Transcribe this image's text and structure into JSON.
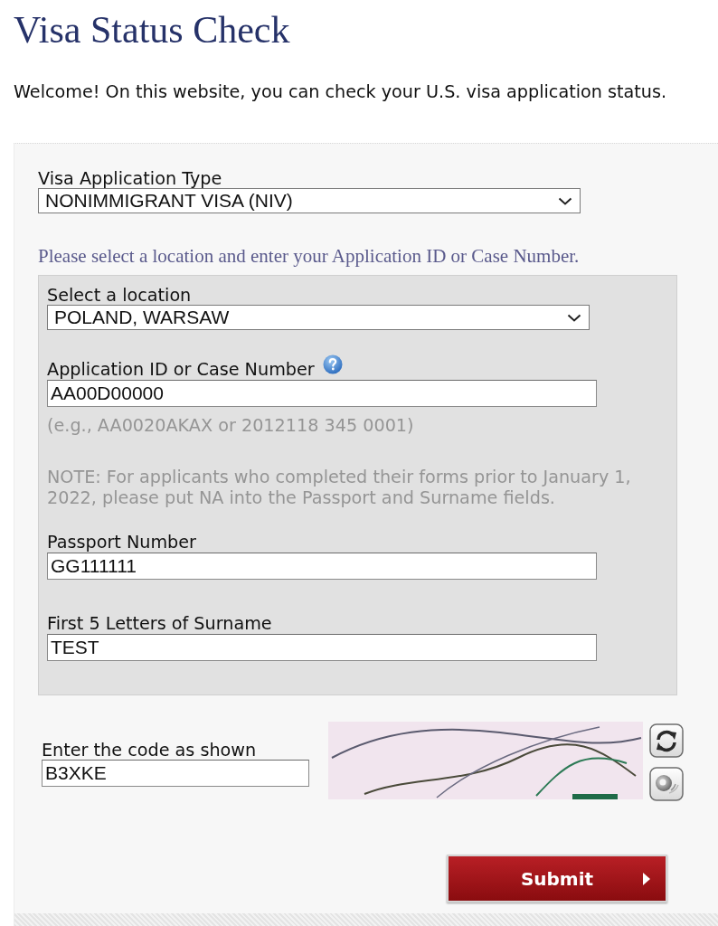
{
  "title": "Visa Status Check",
  "intro": "Welcome! On this website, you can check your U.S. visa application status.",
  "visa_type": {
    "label": "Visa Application Type",
    "value": "NONIMMIGRANT VISA (NIV)"
  },
  "instruction": "Please select a location and enter your Application ID or Case Number.",
  "panel": {
    "items": [
      {
        "kind": "select",
        "label": "Select a location",
        "value": "POLAND, WARSAW",
        "help": false
      },
      {
        "kind": "input",
        "label": "Application ID or Case Number",
        "value": "AA00D00000",
        "help": true,
        "hint": "(e.g., AA0020AKAX or 2012118 345 0001)"
      },
      {
        "kind": "note",
        "text": "NOTE: For applicants who completed their forms prior to January 1, 2022, please put NA into the Passport and Surname fields."
      },
      {
        "kind": "input",
        "label": "Passport Number",
        "value": "GG111111",
        "help": false
      },
      {
        "kind": "input",
        "label": "First 5 Letters of Surname",
        "value": "TEST",
        "help": false
      }
    ]
  },
  "captcha": {
    "label": "Enter the code as shown",
    "value": "B3XKE"
  },
  "submit": {
    "label": "Submit"
  }
}
